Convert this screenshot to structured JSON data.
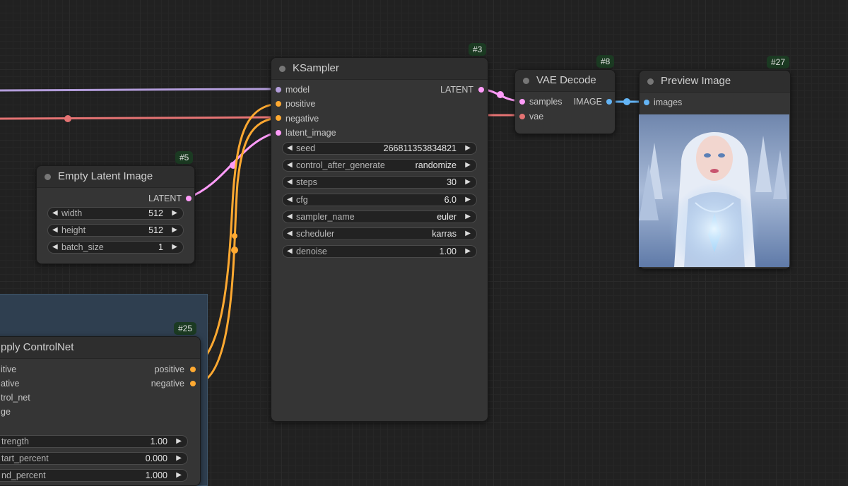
{
  "colors": {
    "model": "#b39ddb",
    "clip": "#e57373",
    "latent": "#ff9cf9",
    "conditioning": "#ffa931",
    "image": "#64b5f6",
    "badge": "#1b3a22"
  },
  "nodes": {
    "ksampler": {
      "id": "#3",
      "title": "KSampler",
      "inputs": [
        "model",
        "positive",
        "negative",
        "latent_image"
      ],
      "output": "LATENT",
      "widgets": [
        {
          "label": "seed",
          "value": "266811353834821"
        },
        {
          "label": "control_after_generate",
          "value": "randomize"
        },
        {
          "label": "steps",
          "value": "30"
        },
        {
          "label": "cfg",
          "value": "6.0"
        },
        {
          "label": "sampler_name",
          "value": "euler"
        },
        {
          "label": "scheduler",
          "value": "karras"
        },
        {
          "label": "denoise",
          "value": "1.00"
        }
      ]
    },
    "vae_decode": {
      "id": "#8",
      "title": "VAE Decode",
      "inputs": [
        "samples",
        "vae"
      ],
      "output": "IMAGE"
    },
    "preview_image": {
      "id": "#27",
      "title": "Preview Image",
      "inputs": [
        "images"
      ]
    },
    "empty_latent": {
      "id": "#5",
      "title": "Empty Latent Image",
      "output": "LATENT",
      "widgets": [
        {
          "label": "width",
          "value": "512"
        },
        {
          "label": "height",
          "value": "512"
        },
        {
          "label": "batch_size",
          "value": "1"
        }
      ]
    },
    "apply_controlnet": {
      "id": "#25",
      "title": "pply ControlNet",
      "inputs": [
        "itive",
        "ative",
        "trol_net",
        "ge"
      ],
      "outputs": [
        "positive",
        "negative"
      ],
      "widgets": [
        {
          "label": "trength",
          "value": "1.00"
        },
        {
          "label": "tart_percent",
          "value": "0.000"
        },
        {
          "label": "nd_percent",
          "value": "1.000"
        }
      ]
    }
  },
  "icons": {
    "arrow_left": "◀",
    "arrow_right": "▶"
  }
}
